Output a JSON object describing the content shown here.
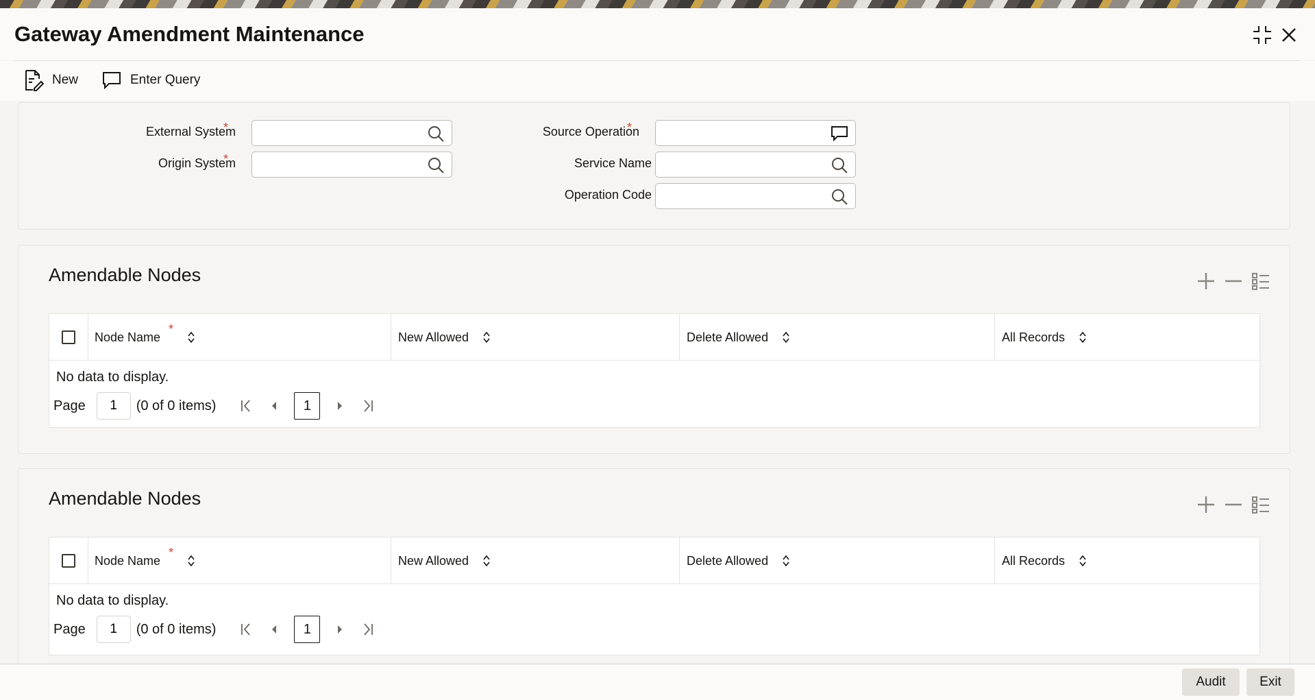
{
  "window": {
    "title": "Gateway Amendment Maintenance",
    "controls": [
      {
        "name": "collapse-icon"
      },
      {
        "name": "close-icon"
      }
    ]
  },
  "toolbar": {
    "new_label": "New",
    "new_icon": "document-edit-icon",
    "query_label": "Enter Query",
    "query_icon": "speech-bubble-icon"
  },
  "form": {
    "external_system": {
      "label": "External System",
      "required": "*",
      "value": "",
      "icon": "search-icon"
    },
    "origin_system": {
      "label": "Origin System",
      "required": "*",
      "value": "",
      "icon": "search-icon"
    },
    "source_operation": {
      "label": "Source Operation",
      "required": "*",
      "value": "",
      "icon": "speech-bubble-icon"
    },
    "service_name": {
      "label": "Service Name",
      "value": "",
      "icon": "search-icon"
    },
    "operation_code": {
      "label": "Operation Code",
      "value": "",
      "icon": "search-icon"
    }
  },
  "sections": [
    {
      "title": "Amendable Nodes",
      "columns": [
        "Node Name",
        "New Allowed",
        "Delete Allowed",
        "All Records"
      ],
      "required_marker": "*",
      "empty_text": "No data to display.",
      "pager": {
        "page_label": "Page",
        "page_value": "1",
        "summary": "(0 of 0 items)",
        "current": "1"
      }
    },
    {
      "title": "Amendable Nodes",
      "columns": [
        "Node Name",
        "New Allowed",
        "Delete Allowed",
        "All Records"
      ],
      "required_marker": "*",
      "empty_text": "No data to display.",
      "pager": {
        "page_label": "Page",
        "page_value": "1",
        "summary": "(0 of 0 items)",
        "current": "1"
      }
    }
  ],
  "footer": {
    "audit_label": "Audit",
    "exit_label": "Exit"
  },
  "colors": {
    "required": "#c74634",
    "background": "#f5f4f2",
    "text": "#161513"
  }
}
